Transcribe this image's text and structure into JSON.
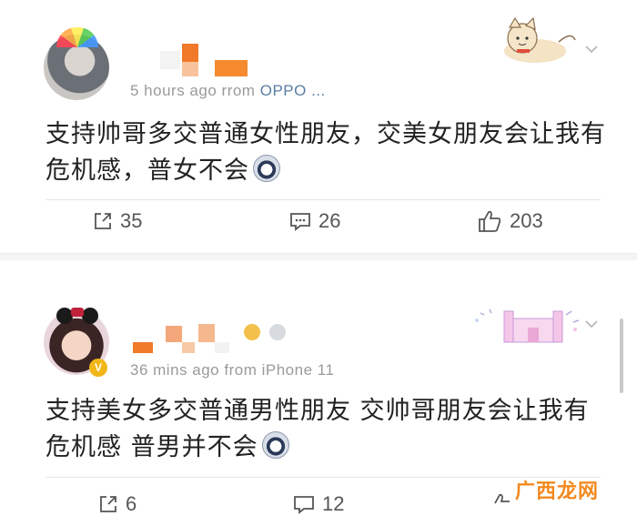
{
  "posts": [
    {
      "meta": {
        "time": "5 hours ago",
        "from": "rrom",
        "source": "OPPO ..."
      },
      "content": {
        "text": "支持帅哥多交普通女性朋友，交美女朋友会让我有危机感，普女不会"
      },
      "actions": {
        "repost": "35",
        "comment": "26",
        "like": "203"
      }
    },
    {
      "meta": {
        "time": "36 mins ago",
        "from": "from",
        "source": "iPhone 11"
      },
      "content": {
        "text": "支持美女多交普通男性朋友 交帅哥朋友会让我有危机感 普男并不会"
      },
      "actions": {
        "repost": "6",
        "comment": "12",
        "like": ""
      }
    }
  ],
  "icons": {
    "repost": "repost-icon",
    "comment": "comment-icon",
    "like": "like-icon",
    "chevron": "chevron-down-icon"
  },
  "colors": {
    "text": "#222222",
    "meta": "#9a9a9a",
    "source": "#5b7ea5",
    "redaction": "#f07a2a"
  },
  "watermark": "广西龙网"
}
